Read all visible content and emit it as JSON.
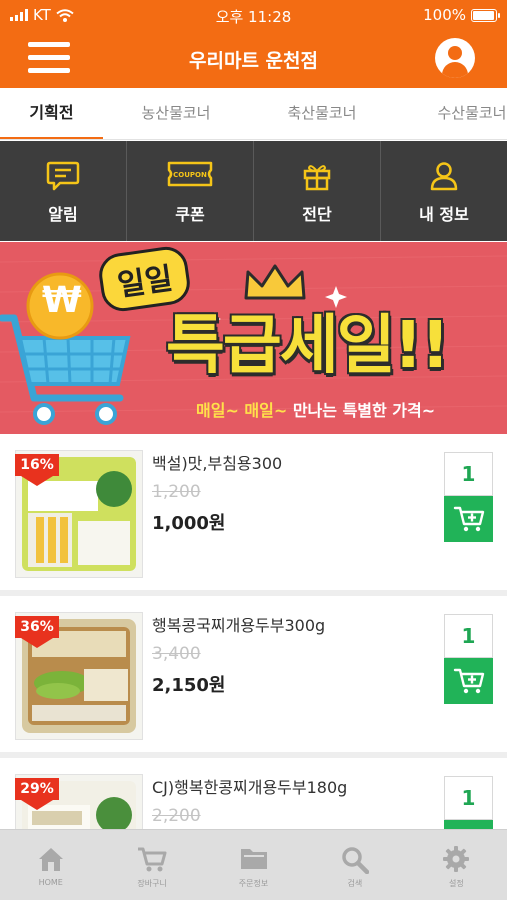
{
  "status_bar": {
    "carrier": "KT",
    "time": "오후 11:28",
    "battery": "100%",
    "battery_level": 1.0
  },
  "header": {
    "title": "우리마트 운천점"
  },
  "tabs": [
    {
      "label": "기획전",
      "active": true
    },
    {
      "label": "농산물코너",
      "active": false
    },
    {
      "label": "축산물코너",
      "active": false
    },
    {
      "label": "수산물코너",
      "active": false
    }
  ],
  "quick_menu": [
    {
      "label": "알림",
      "icon": "chat-icon"
    },
    {
      "label": "쿠폰",
      "icon": "coupon-icon",
      "icon_text": "COUPON"
    },
    {
      "label": "전단",
      "icon": "gift-icon"
    },
    {
      "label": "내 정보",
      "icon": "person-icon"
    }
  ],
  "banner": {
    "badge": "일일",
    "headline": "특급세일!!",
    "currency_symbol": "₩",
    "sub_highlight": "매일~ 매일~",
    "sub_text": " 만나는 특별한 가격~"
  },
  "products": [
    {
      "name": "백설)맛,부침용300",
      "discount": "16%",
      "original_price": "1,200",
      "price": "1,000원",
      "quantity": "1",
      "image": "tofu-package"
    },
    {
      "name": "행복콩국찌개용두부300g",
      "discount": "36%",
      "original_price": "3,400",
      "price": "2,150원",
      "quantity": "1",
      "image": "bean-tofu-package"
    },
    {
      "name": "CJ)행복한콩찌개용두부180g",
      "discount": "29%",
      "original_price": "2,200",
      "price": "",
      "quantity": "1",
      "image": "bean-tofu-package"
    }
  ],
  "bottom_nav": [
    {
      "label": "HOME",
      "icon": "home-icon"
    },
    {
      "label": "장바구니",
      "icon": "cart-icon"
    },
    {
      "label": "주문정보",
      "icon": "folder-icon"
    },
    {
      "label": "검색",
      "icon": "search-icon"
    },
    {
      "label": "설정",
      "icon": "gear-icon"
    }
  ],
  "colors": {
    "accent": "#f36c13",
    "quick_menu_bg": "#3d3d3d",
    "banner_bg": "#e45a62",
    "cart_green": "#21b358",
    "discount_red": "#e8321e"
  }
}
